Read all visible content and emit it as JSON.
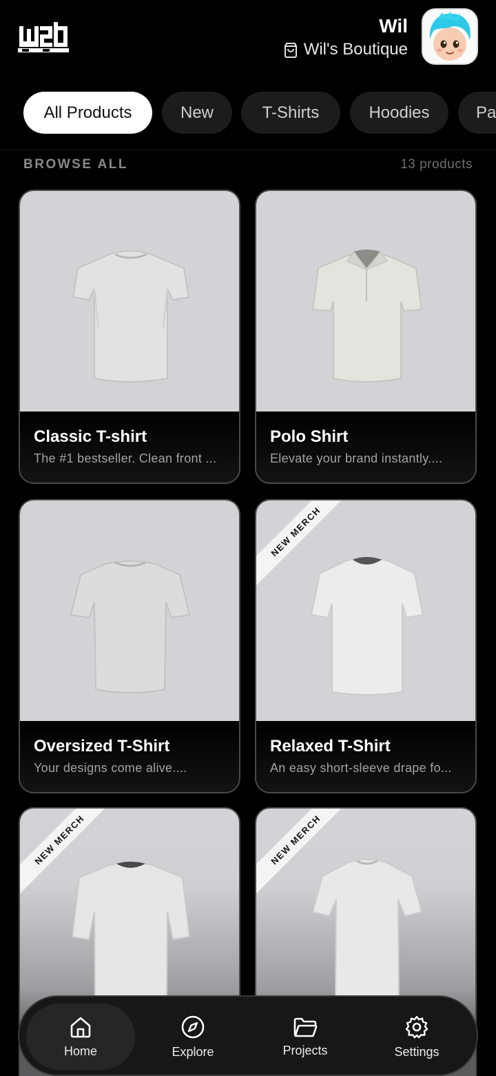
{
  "header": {
    "logo_alt": "w2d",
    "user_name": "Wil",
    "store_name": "Wil's Boutique"
  },
  "categories": [
    {
      "label": "All Products",
      "active": true
    },
    {
      "label": "New",
      "active": false
    },
    {
      "label": "T-Shirts",
      "active": false
    },
    {
      "label": "Hoodies",
      "active": false
    },
    {
      "label": "Pa",
      "active": false
    }
  ],
  "section": {
    "title": "BROWSE ALL",
    "count": "13 products"
  },
  "products": [
    {
      "title": "Classic T-shirt",
      "desc": "The #1 bestseller. Clean front ...",
      "badge": ""
    },
    {
      "title": "Polo Shirt",
      "desc": "Elevate your brand instantly....",
      "badge": ""
    },
    {
      "title": "Oversized T-Shirt",
      "desc": "Your designs come alive....",
      "badge": ""
    },
    {
      "title": "Relaxed T-Shirt",
      "desc": "An easy short-sleeve drape fo...",
      "badge": "NEW MERCH"
    },
    {
      "title": "",
      "desc": "",
      "badge": "NEW MERCH"
    },
    {
      "title": "",
      "desc": "",
      "badge": "NEW MERCH"
    }
  ],
  "nav": [
    {
      "label": "Home",
      "icon": "home-icon",
      "active": true
    },
    {
      "label": "Explore",
      "icon": "compass-icon",
      "active": false
    },
    {
      "label": "Projects",
      "icon": "folder-icon",
      "active": false
    },
    {
      "label": "Settings",
      "icon": "gear-icon",
      "active": false
    }
  ],
  "colors": {
    "background": "#000000",
    "chip_active": "#ffffff",
    "chip_inactive": "#1c1c1c",
    "card_image_bg": "#d3d3d7",
    "avatar_hair": "#2ec9e8"
  }
}
